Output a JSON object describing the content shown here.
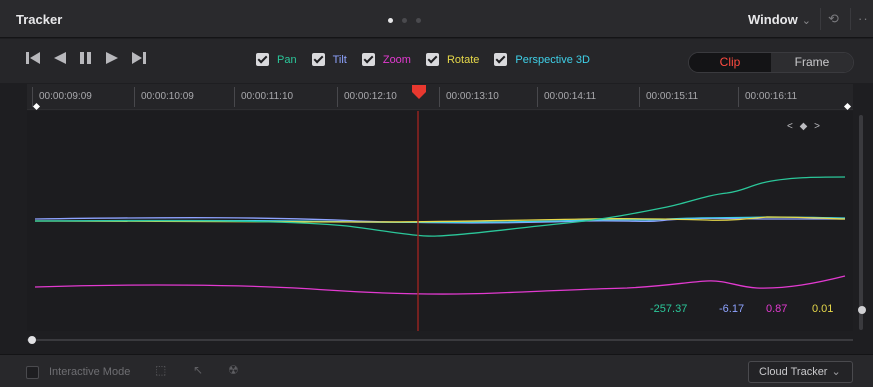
{
  "header": {
    "title": "Tracker",
    "window_label": "Window",
    "dropdown_icon": "chevron-down",
    "reset_icon": "circular-arrow",
    "menu_icon": "ellipsis"
  },
  "transport": {
    "icons": [
      "skip-to-start",
      "play-reverse",
      "pause",
      "play-forward",
      "skip-to-end"
    ]
  },
  "filters": [
    {
      "label": "Pan",
      "color": "#2bc79a",
      "checked": true
    },
    {
      "label": "Tilt",
      "color": "#8ea3ff",
      "checked": true
    },
    {
      "label": "Zoom",
      "color": "#e23ad0",
      "checked": true
    },
    {
      "label": "Rotate",
      "color": "#e6d84a",
      "checked": true
    },
    {
      "label": "Perspective 3D",
      "color": "#3fd0e8",
      "checked": true
    }
  ],
  "mode_toggle": {
    "clip": "Clip",
    "frame": "Frame",
    "active": "Clip",
    "active_color": "#ff4b41"
  },
  "timeline": {
    "timecodes": [
      "00:00:09:09",
      "00:00:10:09",
      "00:00:11:10",
      "00:00:12:10",
      "00:00:13:10",
      "00:00:14:11",
      "00:00:15:11",
      "00:00:16:11"
    ],
    "playhead_color": "#e8382f"
  },
  "graph": {
    "keyframe_nav": "< ◆ >",
    "values": [
      {
        "label": "-257.37",
        "color": "#2bc79a"
      },
      {
        "label": "-6.17",
        "color": "#8ea3ff"
      },
      {
        "label": "0.87",
        "color": "#e23ad0"
      },
      {
        "label": "0.01",
        "color": "#e6d84a"
      }
    ]
  },
  "footer": {
    "interactive_mode": "Interactive Mode",
    "cloud_tracker": "Cloud Tracker"
  }
}
